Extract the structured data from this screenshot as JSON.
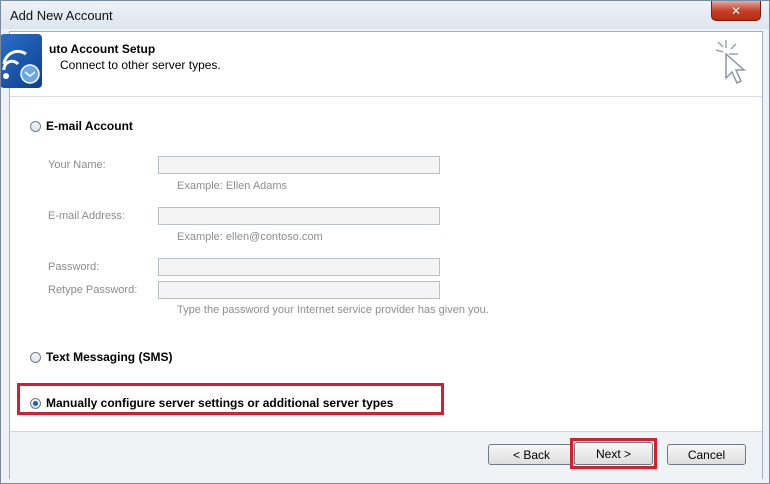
{
  "window": {
    "title": "Add New Account",
    "close_glyph": "✕"
  },
  "header": {
    "title": "uto Account Setup",
    "subtitle": "Connect to other server types.",
    "left_icon": "email-wireless-icon",
    "right_icon": "wizard-cursor-icon"
  },
  "options": {
    "email_account": {
      "label": "E-mail Account",
      "checked": false
    },
    "text_messaging": {
      "label": "Text Messaging (SMS)",
      "checked": false
    },
    "manual": {
      "label": "Manually configure server settings or additional server types",
      "checked": true
    }
  },
  "fields": {
    "your_name": {
      "label": "Your Name:",
      "value": "",
      "hint": "Example: Ellen Adams"
    },
    "email_address": {
      "label": "E-mail Address:",
      "value": "",
      "hint": "Example: ellen@contoso.com"
    },
    "password": {
      "label": "Password:",
      "value": ""
    },
    "retype_password": {
      "label": "Retype Password:",
      "value": "",
      "hint": "Type the password your Internet service provider has given you."
    }
  },
  "buttons": {
    "back": "< Back",
    "next": "Next >",
    "cancel": "Cancel"
  },
  "colors": {
    "highlight": "#d4202e",
    "accent": "#1f5fb2"
  }
}
